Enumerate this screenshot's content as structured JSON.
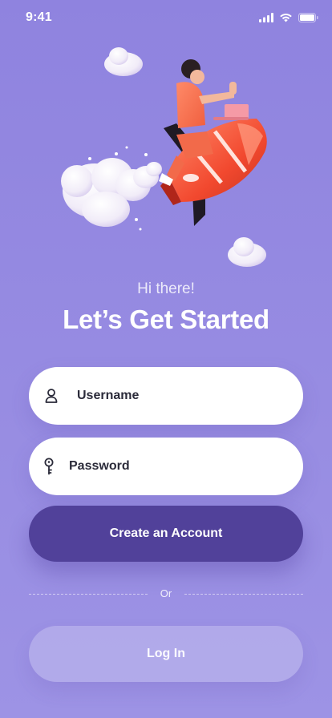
{
  "status_bar": {
    "time": "9:41",
    "icons": [
      "cellular-signal-icon",
      "wifi-icon",
      "battery-icon"
    ]
  },
  "hero": {
    "illustration": "rocket-rider-illustration"
  },
  "header": {
    "greeting": "Hi there!",
    "title": "Let’s Get Started"
  },
  "form": {
    "username": {
      "placeholder": "Username",
      "value": "",
      "icon": "user-icon"
    },
    "password": {
      "placeholder": "Password",
      "value": "",
      "icon": "key-icon"
    }
  },
  "actions": {
    "create_account_label": "Create an Account",
    "divider_text": "Or",
    "login_label": "Log In"
  },
  "colors": {
    "background": "#9187df",
    "primary_button": "#51419a",
    "field_background": "#ffffff"
  }
}
